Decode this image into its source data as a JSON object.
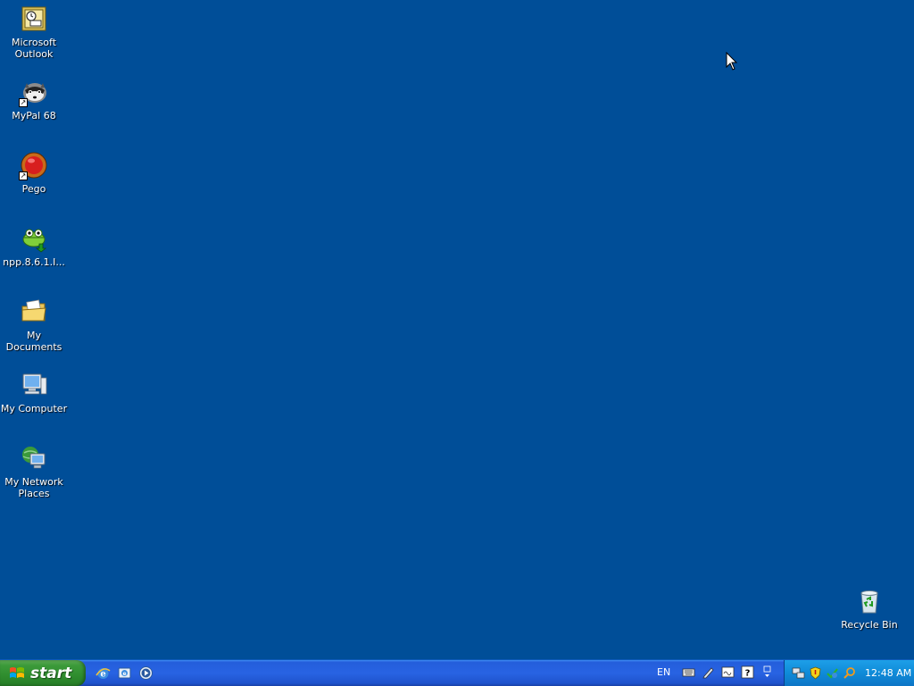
{
  "desktop": {
    "background": "#004e98",
    "icons": [
      {
        "label": "Microsoft\nOutlook",
        "icon": "outlook-icon"
      },
      {
        "label": "MyPal 68",
        "icon": "mypal-icon",
        "shortcut": true
      },
      {
        "label": "Pego",
        "icon": "pego-icon",
        "shortcut": true
      },
      {
        "label": "npp.8.6.1.I...",
        "icon": "notepadpp-installer-icon"
      },
      {
        "label": "My Documents",
        "icon": "my-documents-icon"
      },
      {
        "label": "My Computer",
        "icon": "my-computer-icon"
      },
      {
        "label": "My Network\nPlaces",
        "icon": "my-network-places-icon"
      }
    ],
    "recycle_bin": {
      "label": "Recycle Bin",
      "icon": "recycle-bin-icon"
    }
  },
  "taskbar": {
    "start_label": "start",
    "quick_launch": [
      "internet-explorer-icon",
      "outlook-express-icon",
      "media-player-icon"
    ],
    "language": "EN",
    "language_tools": [
      "keyboard-icon",
      "pen-icon",
      "handwriting-icon",
      "help-icon",
      "options-arrow-icon"
    ],
    "tray_icons": [
      "network-icon",
      "security-shield-icon",
      "update-icon",
      "search-icon"
    ],
    "clock": "12:48 AM"
  }
}
